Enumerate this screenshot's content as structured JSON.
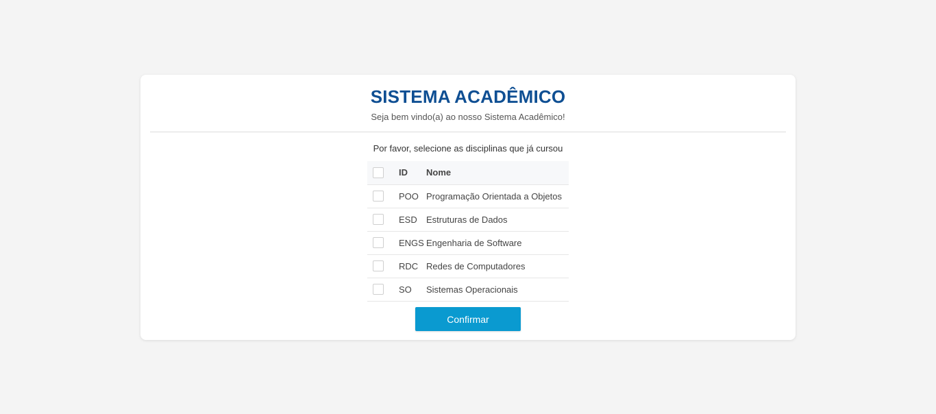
{
  "header": {
    "title": "SISTEMA ACADÊMICO",
    "subtitle": "Seja bem vindo(a) ao nosso Sistema Acadêmico!"
  },
  "form": {
    "instruction": "Por favor, selecione as disciplinas que já cursou",
    "columns": {
      "id": "ID",
      "name": "Nome"
    },
    "rows": [
      {
        "id": "POO",
        "name": "Programação Orientada a Objetos",
        "checked": false
      },
      {
        "id": "ESD",
        "name": "Estruturas de Dados",
        "checked": false
      },
      {
        "id": "ENGS",
        "name": "Engenharia de Software",
        "checked": false
      },
      {
        "id": "RDC",
        "name": "Redes de Computadores",
        "checked": false
      },
      {
        "id": "SO",
        "name": "Sistemas Operacionais",
        "checked": false
      }
    ],
    "confirm_label": "Confirmar"
  },
  "colors": {
    "title": "#0f4f93",
    "button": "#0a9ad0",
    "background": "#f4f4f4"
  }
}
